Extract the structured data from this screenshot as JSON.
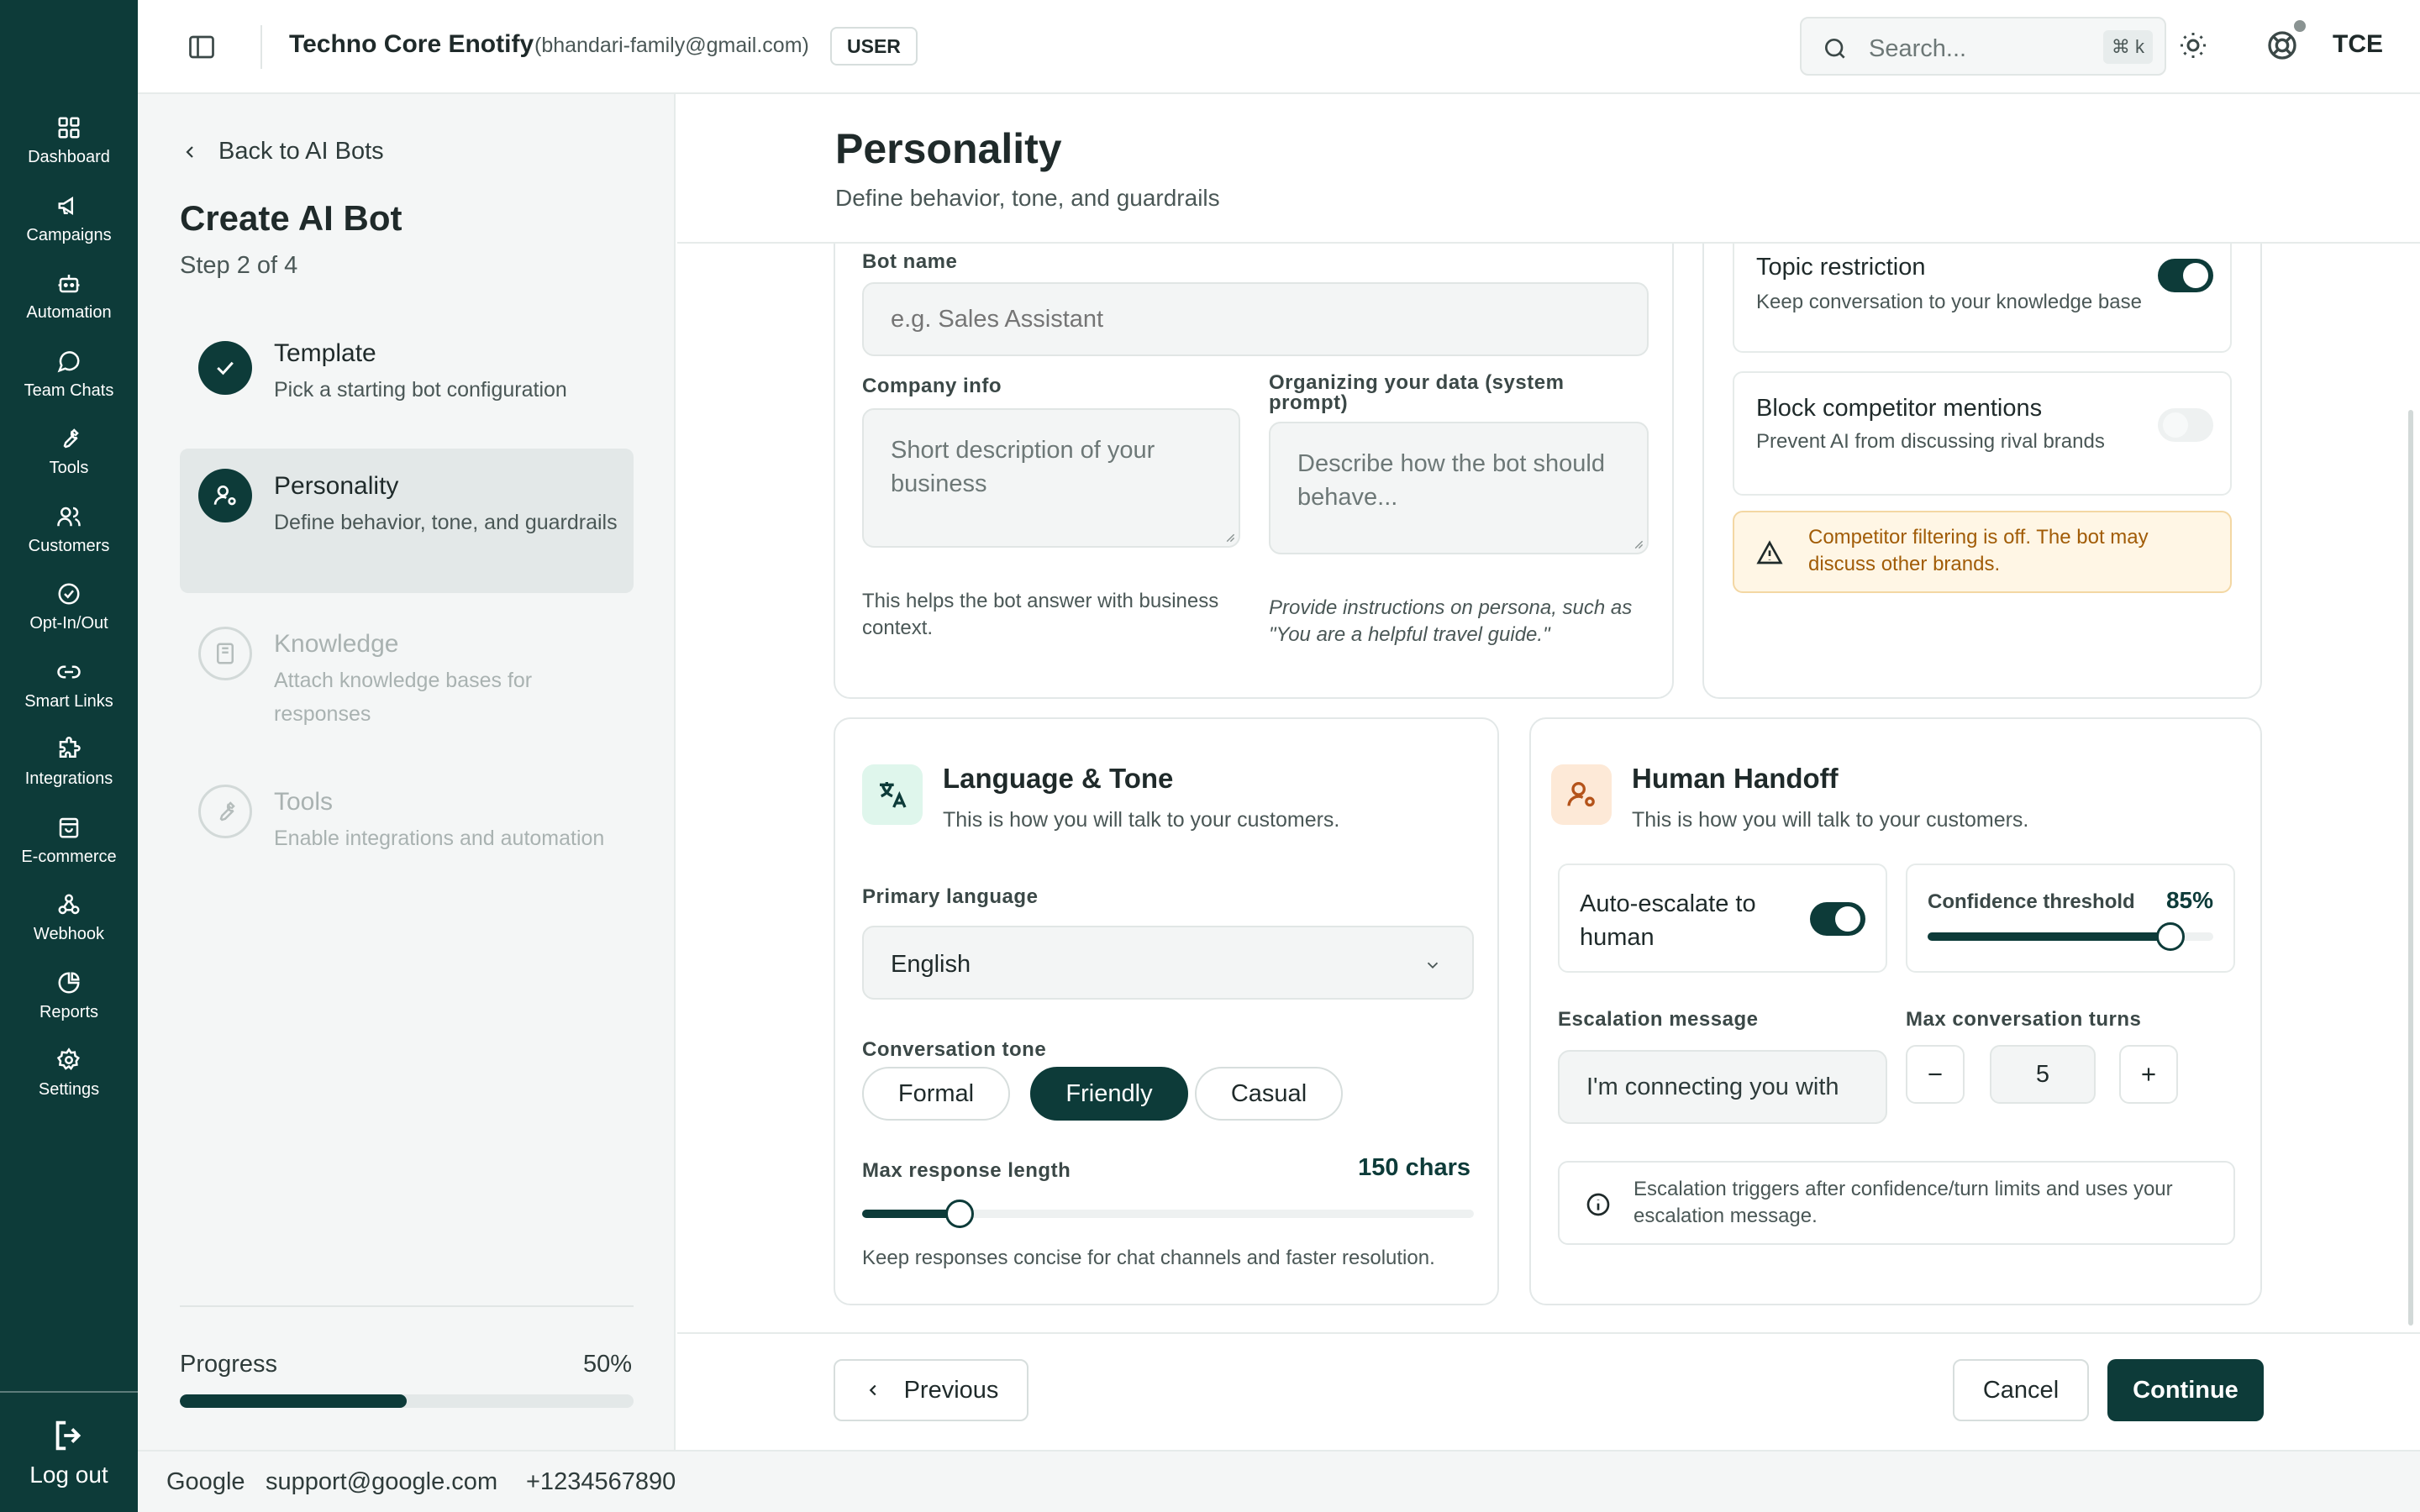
{
  "rail": {
    "items": [
      {
        "label": "Dashboard",
        "icon": "grid-icon"
      },
      {
        "label": "Campaigns",
        "icon": "megaphone-icon"
      },
      {
        "label": "Automation",
        "icon": "robot-icon"
      },
      {
        "label": "Team Chats",
        "icon": "chat-bubble-icon"
      },
      {
        "label": "Tools",
        "icon": "wrench-icon"
      },
      {
        "label": "Customers",
        "icon": "users-icon"
      },
      {
        "label": "Opt-In/Out",
        "icon": "check-circle-icon"
      },
      {
        "label": "Smart Links",
        "icon": "link-icon"
      },
      {
        "label": "Integrations",
        "icon": "puzzle-icon"
      },
      {
        "label": "E-commerce",
        "icon": "shopping-bag-icon"
      },
      {
        "label": "Webhook",
        "icon": "webhook-icon"
      },
      {
        "label": "Reports",
        "icon": "pie-chart-icon"
      },
      {
        "label": "Settings",
        "icon": "gear-icon"
      }
    ],
    "logout_label": "Log out"
  },
  "topbar": {
    "org_name": "Techno Core Enotify",
    "org_email": "(bhandari-family@gmail.com)",
    "role": "USER",
    "search_placeholder": "Search...",
    "search_shortcut": "⌘ k",
    "user_initials": "TCE"
  },
  "stepper": {
    "back_label": "Back to AI Bots",
    "title": "Create AI Bot",
    "step_count": "Step 2 of 4",
    "steps": [
      {
        "title": "Template",
        "desc": "Pick a starting bot configuration",
        "state": "done"
      },
      {
        "title": "Personality",
        "desc": "Define behavior, tone, and guardrails",
        "state": "active"
      },
      {
        "title": "Knowledge",
        "desc": "Attach knowledge bases for responses",
        "state": "todo"
      },
      {
        "title": "Tools",
        "desc": "Enable integrations and automation",
        "state": "todo"
      }
    ],
    "progress_label": "Progress",
    "progress_value": "50%",
    "progress_fraction": 0.5
  },
  "page": {
    "title": "Personality",
    "subtitle": "Define behavior, tone, and guardrails"
  },
  "identity": {
    "bot_name_label": "Bot name",
    "bot_name_placeholder": "e.g. Sales Assistant",
    "company_info_label": "Company info",
    "company_info_placeholder": "Short description of your business",
    "company_info_helper": "This helps the bot answer with business context.",
    "system_prompt_label": "Organizing your data (system prompt)",
    "system_prompt_placeholder": "Describe how the bot should behave...",
    "system_prompt_helper": "Provide instructions on persona, such as \"You are a helpful travel guide.\""
  },
  "guardrails": {
    "topic_restriction_title": "Topic restriction",
    "topic_restriction_desc": "Keep conversation to your knowledge base",
    "topic_restriction_on": true,
    "block_competitor_title": "Block competitor mentions",
    "block_competitor_desc": "Prevent AI from discussing rival brands",
    "block_competitor_on": false,
    "warning_text": "Competitor filtering is off. The bot may discuss other brands."
  },
  "language": {
    "title": "Language & Tone",
    "subtitle": "This is how you will talk to your customers.",
    "primary_language_label": "Primary language",
    "primary_language_value": "English",
    "tone_label": "Conversation tone",
    "tones": [
      {
        "label": "Formal",
        "selected": false
      },
      {
        "label": "Friendly",
        "selected": true
      },
      {
        "label": "Casual",
        "selected": false
      }
    ],
    "max_length_label": "Max response length",
    "max_length_value": "150 chars",
    "max_length_fraction": 0.16,
    "max_length_helper": "Keep responses concise for chat channels and faster resolution."
  },
  "handoff": {
    "title": "Human Handoff",
    "subtitle": "This is how you will talk to your customers.",
    "auto_escalate_label": "Auto-escalate to human",
    "auto_escalate_on": true,
    "confidence_label": "Confidence threshold",
    "confidence_value": "85%",
    "confidence_fraction": 0.85,
    "escalation_message_label": "Escalation message",
    "escalation_message_value": "I'm connecting you with",
    "max_turns_label": "Max conversation turns",
    "max_turns_value": "5",
    "info_text": "Escalation triggers after confidence/turn limits and uses your escalation message."
  },
  "actions": {
    "previous_label": "Previous",
    "cancel_label": "Cancel",
    "continue_label": "Continue"
  },
  "statusbar": {
    "company": "Google",
    "email": "support@google.com",
    "phone": "+1234567890"
  },
  "colors": {
    "brand": "#0d3b39",
    "warning_text": "#a15c07",
    "warning_bg": "#fff6e5",
    "language_icon_bg": "#dff6ec",
    "handoff_icon_bg": "#fde9d7"
  }
}
